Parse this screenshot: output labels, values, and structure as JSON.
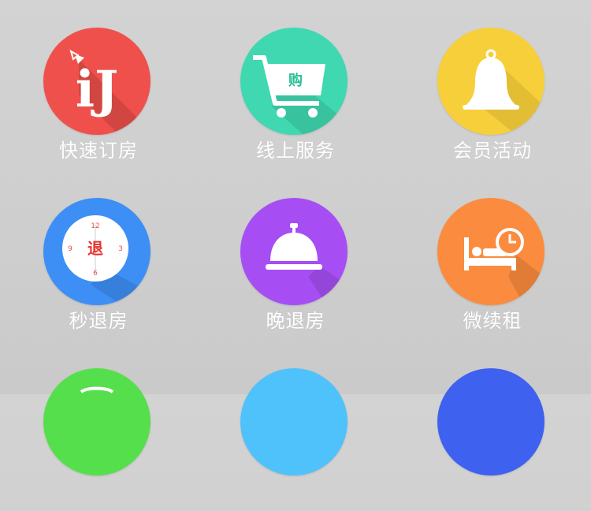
{
  "menu": {
    "items": [
      {
        "label": "快速订房",
        "icon": "hotel-booking-icon",
        "color": "#f0504b"
      },
      {
        "label": "线上服务",
        "icon": "shopping-cart-icon",
        "color": "#3fd8b0",
        "cart_text": "购"
      },
      {
        "label": "会员活动",
        "icon": "bell-icon",
        "color": "#f7cf3a"
      },
      {
        "label": "秒退房",
        "icon": "clock-checkout-icon",
        "color": "#3d8ff5",
        "clock_text": "退",
        "clock_numbers": [
          "12",
          "3",
          "6",
          "9"
        ]
      },
      {
        "label": "晚退房",
        "icon": "service-bell-icon",
        "color": "#a64ef3"
      },
      {
        "label": "微续租",
        "icon": "bed-clock-icon",
        "color": "#fb8b3e"
      },
      {
        "label": "",
        "icon": "partial-icon",
        "color": "#56df4c"
      },
      {
        "label": "",
        "icon": "partial-icon",
        "color": "#4fc2fb"
      },
      {
        "label": "",
        "icon": "partial-icon",
        "color": "#3e61f0"
      }
    ]
  }
}
